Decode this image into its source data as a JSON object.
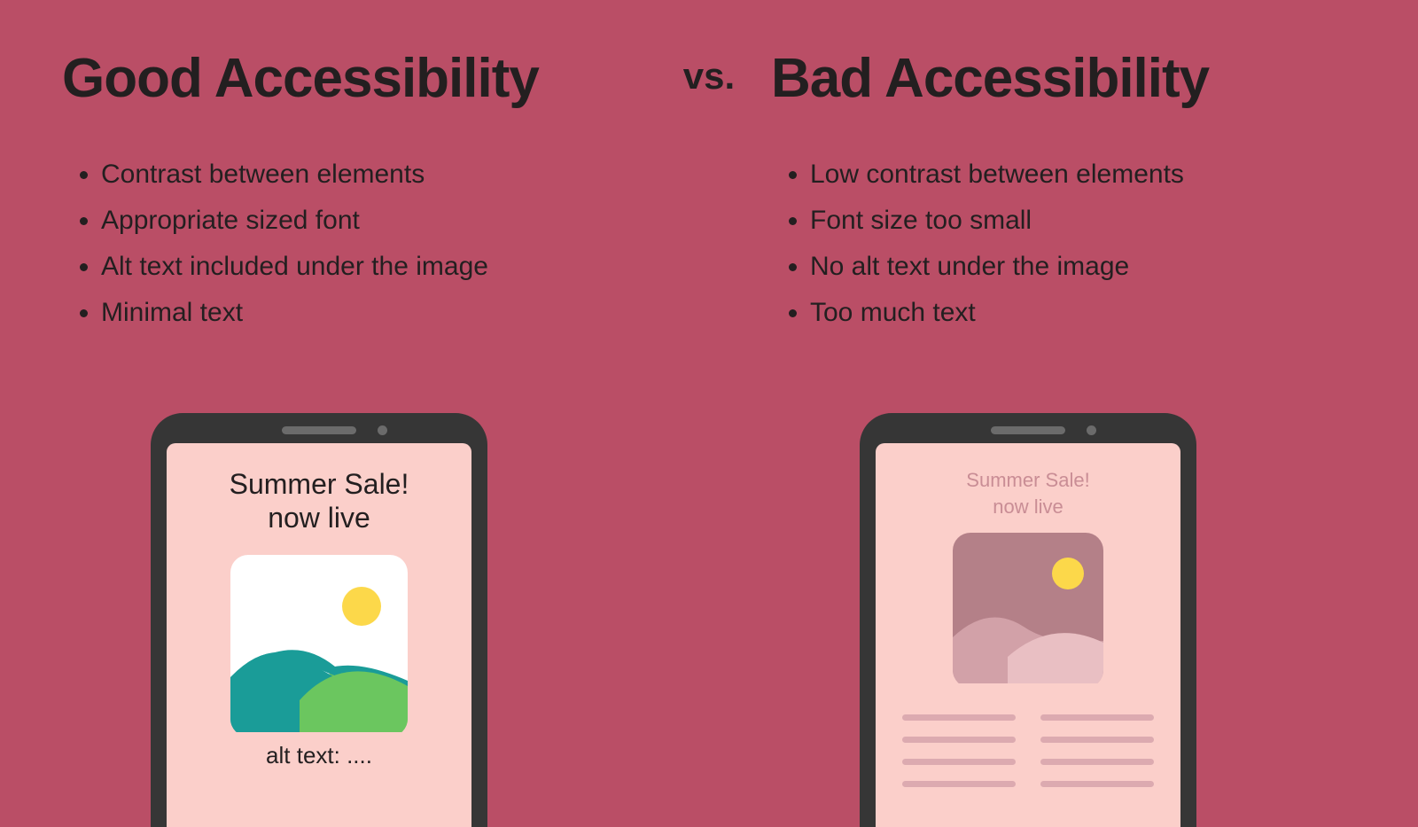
{
  "good": {
    "title": "Good Accessibility",
    "bullets": [
      "Contrast between elements",
      "Appropriate sized font",
      "Alt text included under the image",
      "Minimal text"
    ],
    "phone": {
      "headline1": "Summer Sale!",
      "headline2": "now live",
      "alt_text": "alt text: ...."
    }
  },
  "vs": "vs.",
  "bad": {
    "title": "Bad Accessibility",
    "bullets": [
      "Low contrast between elements",
      "Font size too small",
      "No alt text under the image",
      "Too much text"
    ],
    "phone": {
      "headline1": "Summer Sale!",
      "headline2": "now live"
    }
  }
}
